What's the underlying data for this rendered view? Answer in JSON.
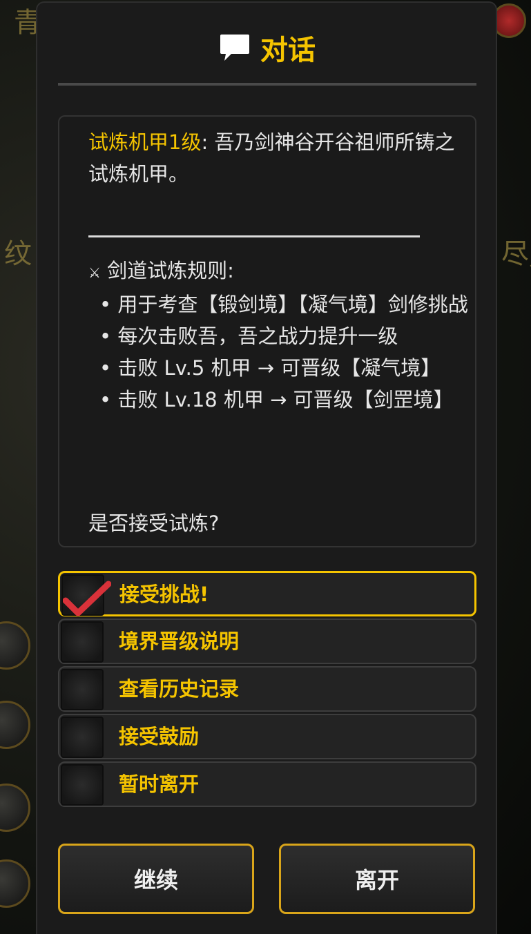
{
  "dialog": {
    "title": "对话",
    "speaker": "试炼机甲1级",
    "intro": ": 吾乃剑神谷开谷祖师所铸之试炼机甲。",
    "rules_heading": "剑道试炼规则:",
    "rules_icon": "⚔",
    "rules": [
      "• 用于考查【锻剑境】【凝气境】剑修挑战",
      "• 每次击败吾，吾之战力提升一级",
      "• 击败 Lv.5 机甲 → 可晋级【凝气境】",
      "• 击败 Lv.18 机甲 → 可晋级【剑罡境】"
    ],
    "question": "是否接受试炼?"
  },
  "options": [
    {
      "label": "接受挑战!",
      "selected": true
    },
    {
      "label": "境界晋级说明",
      "selected": false
    },
    {
      "label": "查看历史记录",
      "selected": false
    },
    {
      "label": "接受鼓励",
      "selected": false
    },
    {
      "label": "暂时离开",
      "selected": false
    }
  ],
  "buttons": {
    "continue_label": "继续",
    "leave_label": "离开"
  },
  "background": {
    "glyph_left_top": "青",
    "glyph_left_mid": "纹",
    "glyph_right_mid": "尽,"
  },
  "colors": {
    "accent": "#f5c400",
    "check": "#d9323a",
    "panel": "#1b1b1b"
  }
}
